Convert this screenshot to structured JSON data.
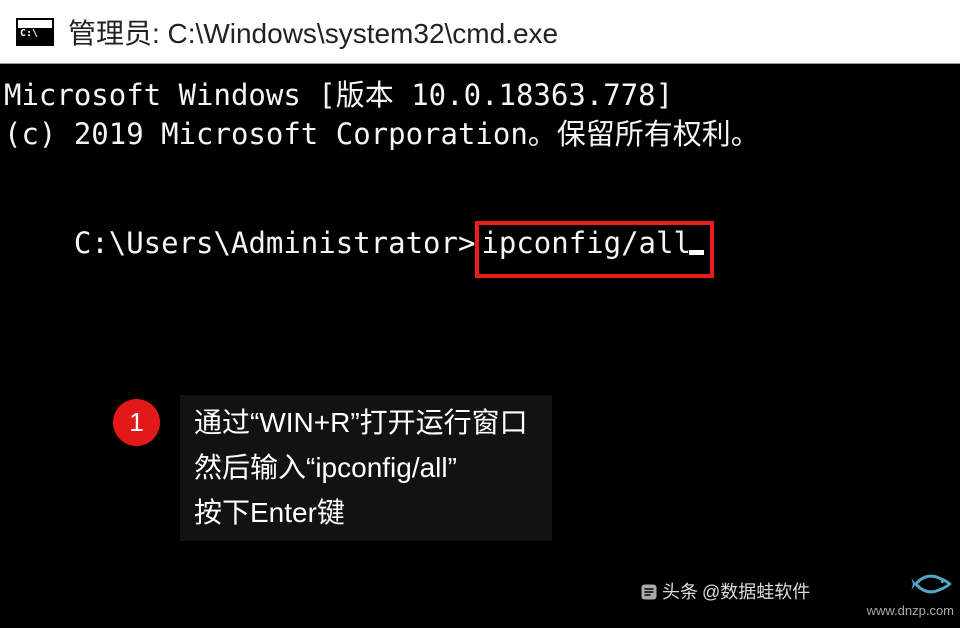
{
  "titlebar": {
    "icon_prompt": "C:\\",
    "label": "管理员: C:\\Windows\\system32\\cmd.exe"
  },
  "terminal": {
    "line1": "Microsoft Windows [版本 10.0.18363.778]",
    "line2": "(c) 2019 Microsoft Corporation。保留所有权利。",
    "prompt": "C:\\Users\\Administrator>",
    "command": "ipconfig/all"
  },
  "callout": {
    "number": "1",
    "line1": "通过“WIN+R”打开运行窗口",
    "line2": "然后输入“ipconfig/all”",
    "line3": "按下Enter键"
  },
  "attribution": {
    "toutiao_prefix": "头条",
    "toutiao_handle": "@数据蛙软件",
    "site": "www.dnzp.com"
  },
  "colors": {
    "highlight_border": "#ea1c1c",
    "badge_bg": "#e31919"
  }
}
